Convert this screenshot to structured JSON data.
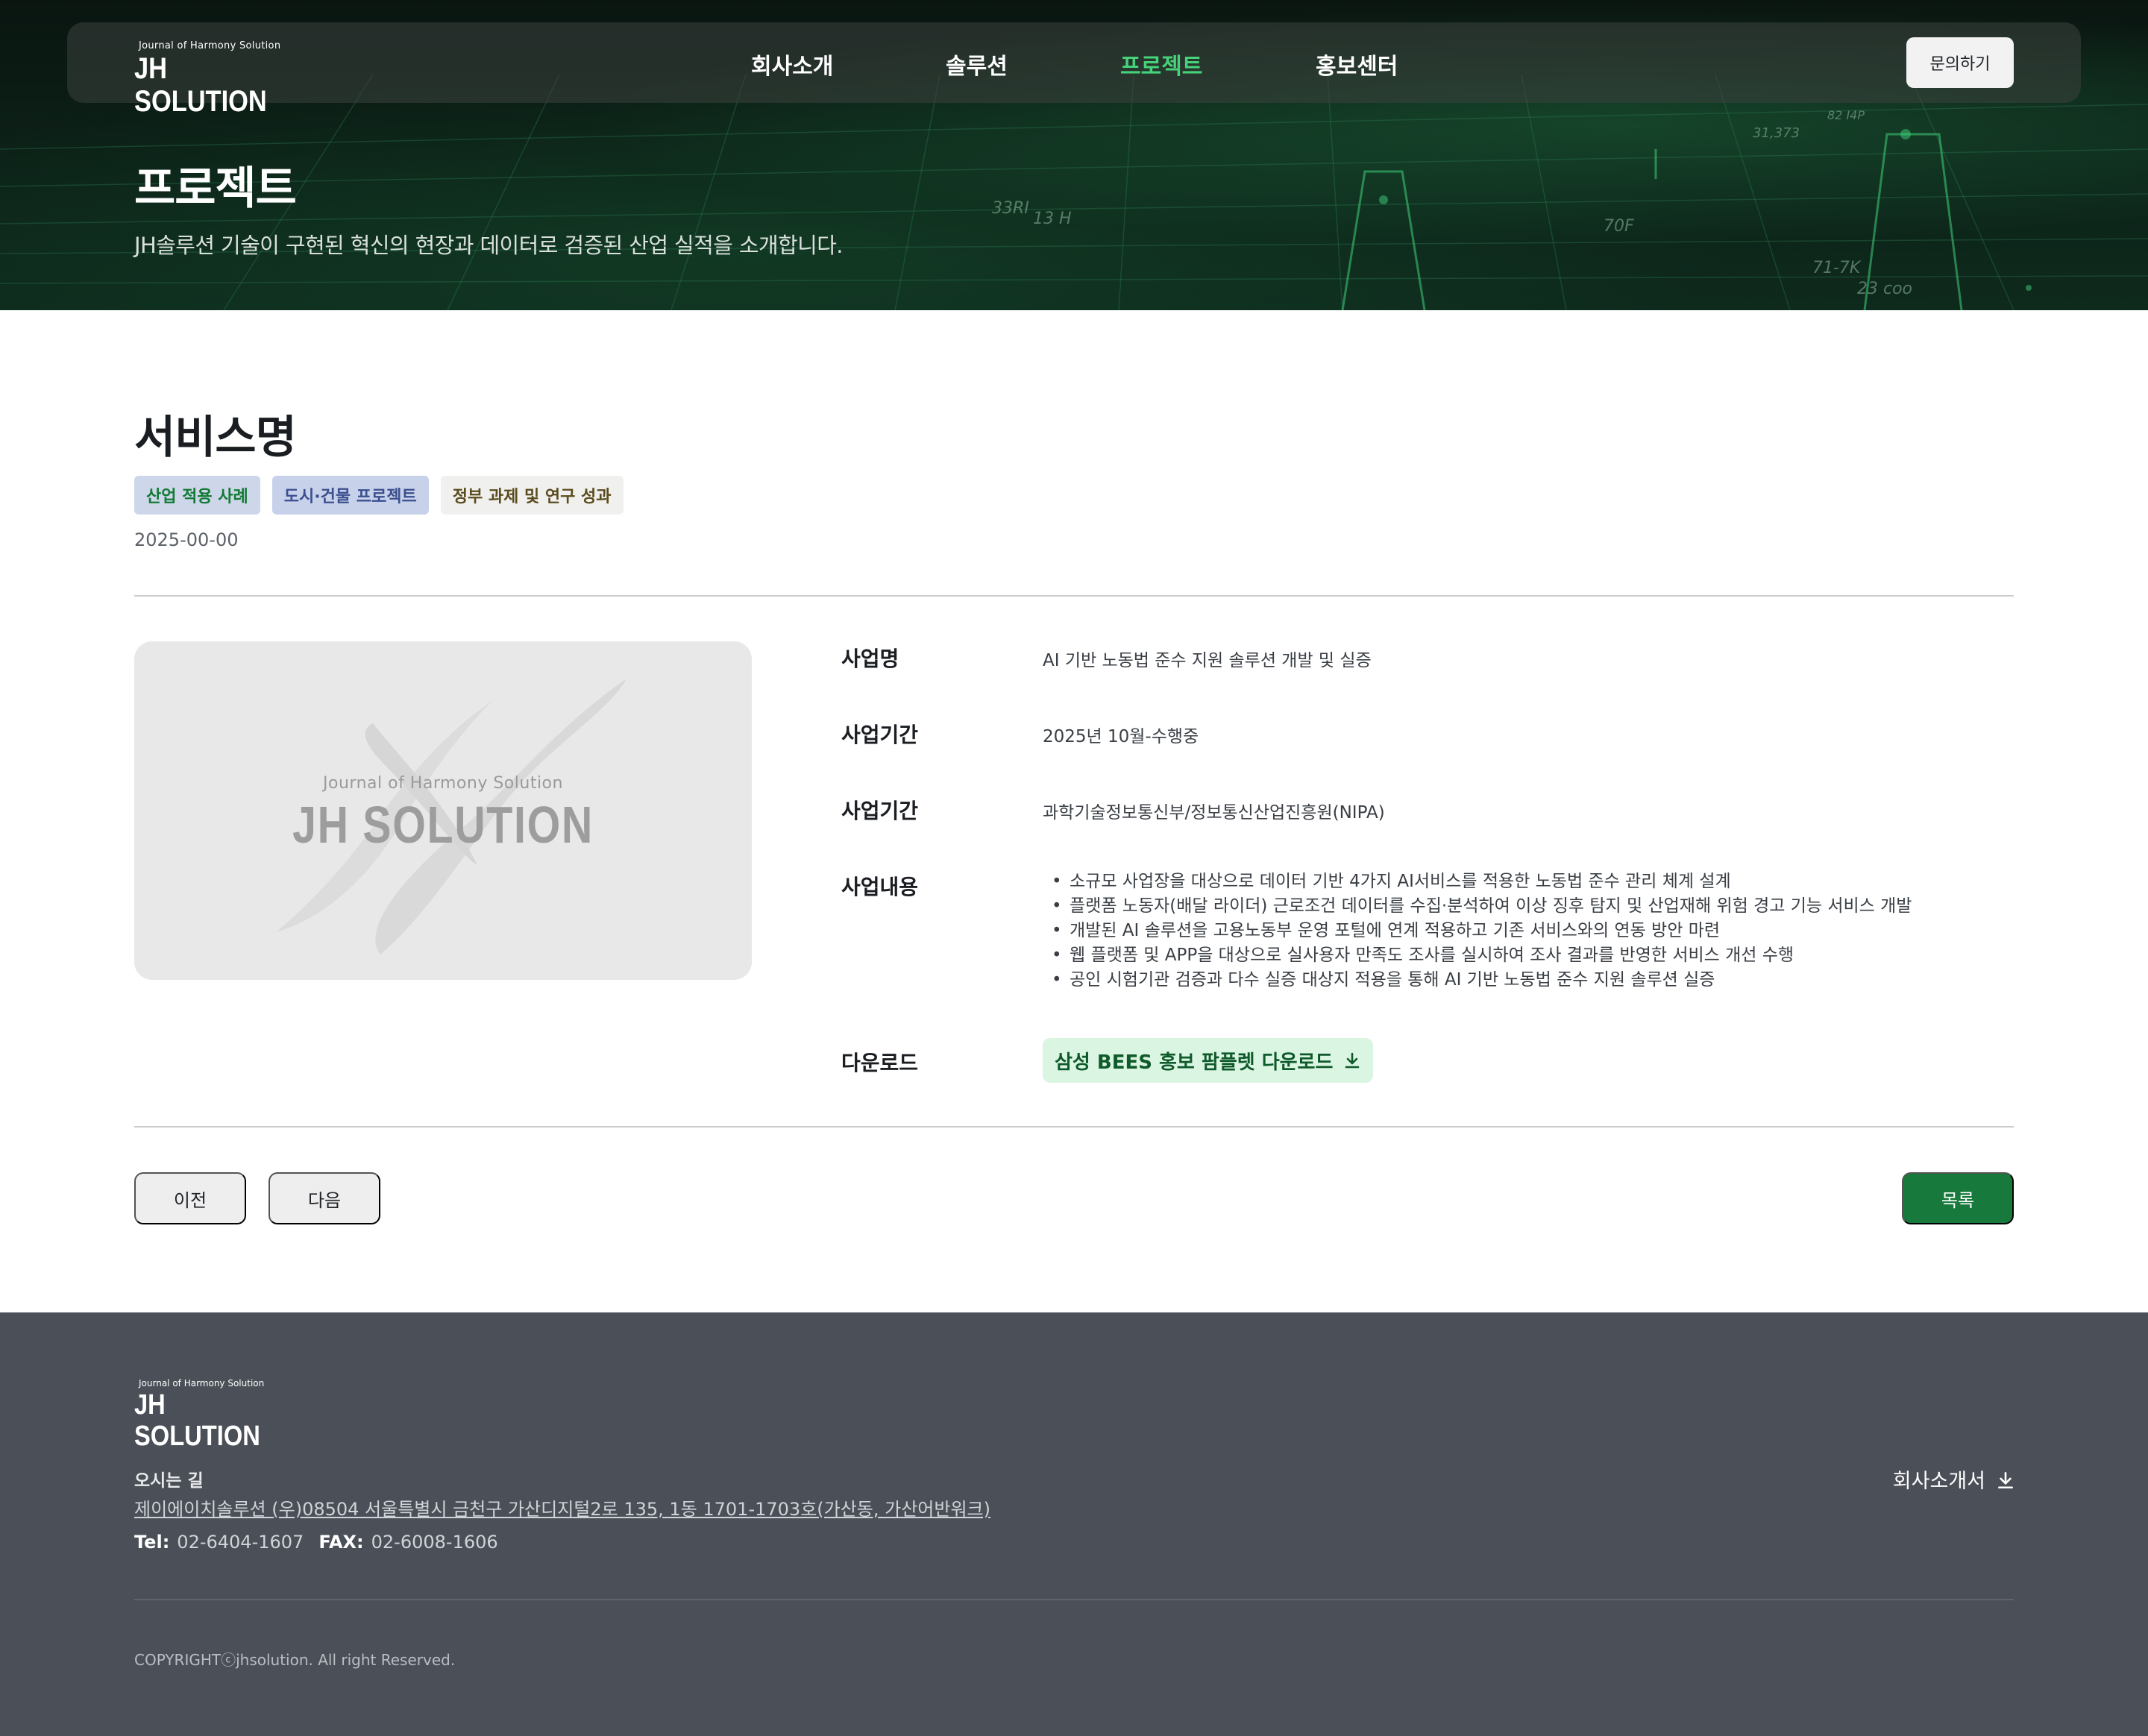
{
  "brand": {
    "sub": "Journal of Harmony Solution",
    "name": "JH SOLUTION"
  },
  "nav": {
    "items": [
      {
        "label": "회사소개",
        "active": false
      },
      {
        "label": "솔루션",
        "active": false
      },
      {
        "label": "프로젝트",
        "active": true
      },
      {
        "label": "홍보센터",
        "active": false
      }
    ],
    "contact_label": "문의하기",
    "active_color": "#46d27a"
  },
  "hero": {
    "title": "프로젝트",
    "subtitle": "JH솔루션 기술이 구현된 혁신의 현장과 데이터로 검증된 산업 실적을 소개합니다.",
    "bg_text": [
      "33RI",
      "13 H",
      "31,373",
      "82 I4P",
      "70F",
      "71-7K",
      "23 coo"
    ]
  },
  "project": {
    "title": "서비스명",
    "tags": [
      "산업 적용 사례",
      "도시·건물 프로젝트",
      "정부 과제 및 연구 성과"
    ],
    "date": "2025-00-00",
    "thumbnail": {
      "sub": "Journal of Harmony Solution",
      "name": "JH SOLUTION"
    },
    "fields": {
      "name_label": "사업명",
      "name_value": "AI 기반 노동법 준수 지원 솔루션 개발 및 실증",
      "period_label": "사업기간",
      "period_value": "2025년 10월-수행중",
      "org_label": "사업기간",
      "org_value": "과학기술정보통신부/정보통신산업진흥원(NIPA)",
      "content_label": "사업내용",
      "content_items": [
        "소규모 사업장을 대상으로 데이터 기반 4가지 AI서비스를 적용한 노동법 준수 관리 체계 설계",
        "플랫폼 노동자(배달 라이더) 근로조건 데이터를 수집·분석하여 이상 징후 탐지 및 산업재해 위험 경고 기능 서비스 개발",
        "개발된 AI 솔루션을 고용노동부 운영 포털에 연계 적용하고 기존 서비스와의 연동 방안 마련",
        "웹 플랫폼 및 APP을 대상으로 실사용자 만족도 조사를 실시하여 조사 결과를 반영한 서비스 개선 수행",
        "공인 시험기관 검증과 다수 실증 대상지 적용을 통해 AI 기반 노동법 준수 지원 솔루션 실증"
      ],
      "download_label": "다운로드",
      "download_button": "삼성 BEES 홍보 팜플렛 다운로드"
    },
    "prev_label": "이전",
    "next_label": "다음",
    "list_label": "목록"
  },
  "footer": {
    "brand": {
      "sub": "Journal of Harmony Solution",
      "name": "JH SOLUTION"
    },
    "directions_label": "오시는 길",
    "address": "제이에이치솔루션 (우)08504 서울특별시 금천구 가산디지털2로 135, 1동 1701-1703호(가산동, 가산어반워크)",
    "tel_label": "Tel:",
    "tel": "02-6404-1607",
    "fax_label": "FAX:",
    "fax": "02-6008-1606",
    "brochure_label": "회사소개서",
    "copyright": "COPYRIGHTⓒjhsolution. All right Reserved."
  },
  "colors": {
    "accent_green": "#177a3c",
    "nav_active": "#46d27a",
    "footer_bg": "#4b5058",
    "download_bg": "#dbf5e3"
  },
  "icons": {
    "download": "download-icon"
  }
}
